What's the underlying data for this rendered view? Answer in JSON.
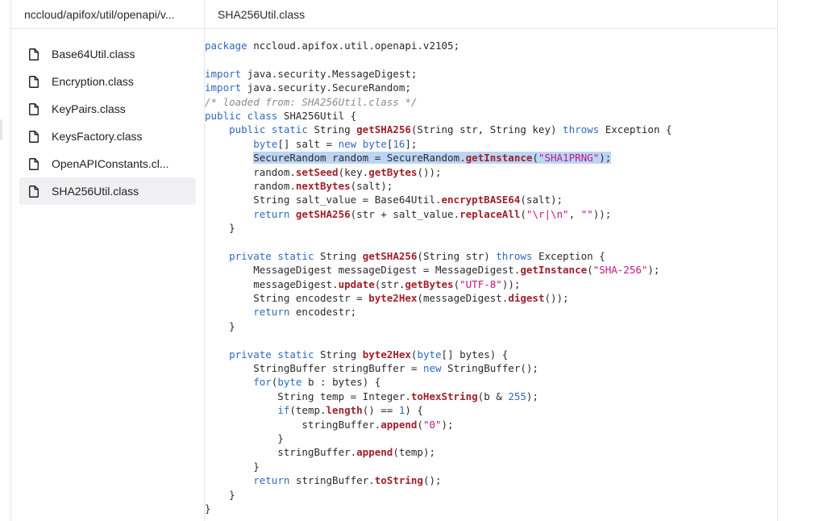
{
  "breadcrumb": "nccloud/apifox/util/openapi/v...",
  "editor_title": "SHA256Util.class",
  "files": [
    {
      "label": "Base64Util.class",
      "active": false
    },
    {
      "label": "Encryption.class",
      "active": false
    },
    {
      "label": "KeyPairs.class",
      "active": false
    },
    {
      "label": "KeysFactory.class",
      "active": false
    },
    {
      "label": "OpenAPIConstants.cl...",
      "active": false
    },
    {
      "label": "SHA256Util.class",
      "active": true
    }
  ],
  "code_lines": [
    [
      [
        "kw",
        "package"
      ],
      [
        "",
        "nccloud.apifox.util.openapi.v2105;"
      ]
    ],
    [],
    [
      [
        "kw",
        "import"
      ],
      [
        "",
        "java.security.MessageDigest;"
      ]
    ],
    [
      [
        "kw",
        "import"
      ],
      [
        "",
        "java.security.SecureRandom;"
      ]
    ],
    [
      [
        "cm",
        "/* loaded from: SHA256Util.class */"
      ]
    ],
    [
      [
        "kw",
        "public class"
      ],
      [
        "",
        "SHA256Util {"
      ]
    ],
    [
      [
        "",
        "    "
      ],
      [
        "kw",
        "public static"
      ],
      [
        "",
        "String "
      ],
      [
        "fn",
        "getSHA256"
      ],
      [
        "",
        "(String str, String key) "
      ],
      [
        "kw",
        "throws"
      ],
      [
        "",
        "Exception {"
      ]
    ],
    [
      [
        "",
        "        "
      ],
      [
        "kw",
        "byte"
      ],
      [
        "",
        "[] salt = "
      ],
      [
        "kw",
        "new byte"
      ],
      [
        "",
        "["
      ],
      [
        "num",
        "16"
      ],
      [
        "",
        "];"
      ]
    ],
    [
      [
        "",
        "        "
      ],
      [
        "hl-start",
        ""
      ],
      [
        "",
        "SecureRandom random = SecureRandom."
      ],
      [
        "fn",
        "getInstance"
      ],
      [
        "",
        "("
      ],
      [
        "str",
        "\"SHA1PRNG\""
      ],
      [
        "",
        ");"
      ],
      [
        "hl-end",
        ""
      ]
    ],
    [
      [
        "",
        "        random."
      ],
      [
        "fn",
        "setSeed"
      ],
      [
        "",
        "(key."
      ],
      [
        "fn",
        "getBytes"
      ],
      [
        "",
        "());"
      ]
    ],
    [
      [
        "",
        "        random."
      ],
      [
        "fn",
        "nextBytes"
      ],
      [
        "",
        "(salt);"
      ]
    ],
    [
      [
        "",
        "        String salt_value = Base64Util."
      ],
      [
        "fn",
        "encryptBASE64"
      ],
      [
        "",
        "(salt);"
      ]
    ],
    [
      [
        "",
        "        "
      ],
      [
        "kw",
        "return"
      ],
      [
        "fn",
        "getSHA256"
      ],
      [
        "",
        "(str + salt_value."
      ],
      [
        "fn",
        "replaceAll"
      ],
      [
        "",
        "("
      ],
      [
        "str",
        "\"\\r|\\n\""
      ],
      [
        "",
        ", "
      ],
      [
        "str",
        "\"\""
      ],
      [
        "",
        "));"
      ]
    ],
    [
      [
        "",
        "    }"
      ]
    ],
    [],
    [
      [
        "",
        "    "
      ],
      [
        "kw",
        "private static"
      ],
      [
        "",
        "String "
      ],
      [
        "fn",
        "getSHA256"
      ],
      [
        "",
        "(String str) "
      ],
      [
        "kw",
        "throws"
      ],
      [
        "",
        "Exception {"
      ]
    ],
    [
      [
        "",
        "        MessageDigest messageDigest = MessageDigest."
      ],
      [
        "fn",
        "getInstance"
      ],
      [
        "",
        "("
      ],
      [
        "str",
        "\"SHA-256\""
      ],
      [
        "",
        ");"
      ]
    ],
    [
      [
        "",
        "        messageDigest."
      ],
      [
        "fn",
        "update"
      ],
      [
        "",
        "(str."
      ],
      [
        "fn",
        "getBytes"
      ],
      [
        "",
        "("
      ],
      [
        "str",
        "\"UTF-8\""
      ],
      [
        "",
        "));"
      ]
    ],
    [
      [
        "",
        "        String encodestr = "
      ],
      [
        "fn",
        "byte2Hex"
      ],
      [
        "",
        "(messageDigest."
      ],
      [
        "fn",
        "digest"
      ],
      [
        "",
        "());"
      ]
    ],
    [
      [
        "",
        "        "
      ],
      [
        "kw",
        "return"
      ],
      [
        "",
        "encodestr;"
      ]
    ],
    [
      [
        "",
        "    }"
      ]
    ],
    [],
    [
      [
        "",
        "    "
      ],
      [
        "kw",
        "private static"
      ],
      [
        "",
        "String "
      ],
      [
        "fn",
        "byte2Hex"
      ],
      [
        "",
        "("
      ],
      [
        "kw",
        "byte"
      ],
      [
        "",
        "[] bytes) {"
      ]
    ],
    [
      [
        "",
        "        StringBuffer stringBuffer = "
      ],
      [
        "kw",
        "new"
      ],
      [
        "",
        "StringBuffer();"
      ]
    ],
    [
      [
        "",
        "        "
      ],
      [
        "kw",
        "for"
      ],
      [
        "",
        "("
      ],
      [
        "kw",
        "byte"
      ],
      [
        "",
        "b : bytes) {"
      ]
    ],
    [
      [
        "",
        "            String temp = Integer."
      ],
      [
        "fn",
        "toHexString"
      ],
      [
        "",
        "(b & "
      ],
      [
        "num",
        "255"
      ],
      [
        "",
        ");"
      ]
    ],
    [
      [
        "",
        "            "
      ],
      [
        "kw",
        "if"
      ],
      [
        "",
        "(temp."
      ],
      [
        "fn",
        "length"
      ],
      [
        "",
        "() == "
      ],
      [
        "num",
        "1"
      ],
      [
        "",
        ") {"
      ]
    ],
    [
      [
        "",
        "                stringBuffer."
      ],
      [
        "fn",
        "append"
      ],
      [
        "",
        "("
      ],
      [
        "str",
        "\"0\""
      ],
      [
        "",
        ");"
      ]
    ],
    [
      [
        "",
        "            }"
      ]
    ],
    [
      [
        "",
        "            stringBuffer."
      ],
      [
        "fn",
        "append"
      ],
      [
        "",
        "(temp);"
      ]
    ],
    [
      [
        "",
        "        }"
      ]
    ],
    [
      [
        "",
        "        "
      ],
      [
        "kw",
        "return"
      ],
      [
        "",
        "stringBuffer."
      ],
      [
        "fn",
        "toString"
      ],
      [
        "",
        "();"
      ]
    ],
    [
      [
        "",
        "    }"
      ]
    ],
    [
      [
        "",
        "}"
      ]
    ]
  ]
}
